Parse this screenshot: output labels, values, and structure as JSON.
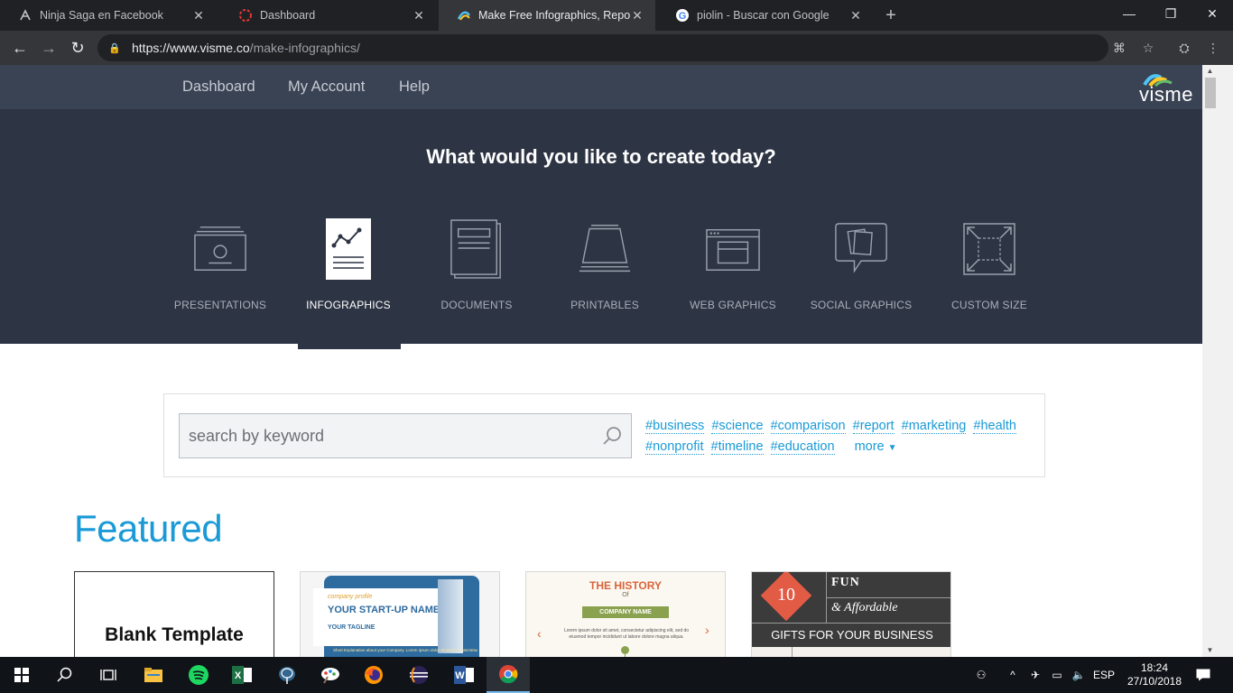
{
  "browser": {
    "tabs": [
      {
        "title": "Ninja Saga en Facebook",
        "icon": "ninja-icon"
      },
      {
        "title": "Dashboard",
        "icon": "dashboard-ring-icon"
      },
      {
        "title": "Make Free Infographics, Reports",
        "icon": "visme-icon",
        "active": true
      },
      {
        "title": "piolin - Buscar con Google",
        "icon": "google-icon"
      }
    ],
    "url_host": "https://www.visme.co",
    "url_path": "/make-infographics/"
  },
  "site": {
    "nav": [
      "Dashboard",
      "My Account",
      "Help"
    ],
    "logo": "visme"
  },
  "hero": {
    "heading": "What would you like to create today?",
    "categories": [
      {
        "label": "PRESENTATIONS",
        "icon": "presentation-icon"
      },
      {
        "label": "INFOGRAPHICS",
        "icon": "infographic-icon",
        "active": true
      },
      {
        "label": "DOCUMENTS",
        "icon": "document-icon"
      },
      {
        "label": "PRINTABLES",
        "icon": "printable-icon"
      },
      {
        "label": "WEB GRAPHICS",
        "icon": "web-graphic-icon"
      },
      {
        "label": "SOCIAL GRAPHICS",
        "icon": "social-graphic-icon"
      },
      {
        "label": "CUSTOM SIZE",
        "icon": "custom-size-icon"
      }
    ]
  },
  "search": {
    "placeholder": "search by keyword",
    "tags": [
      "#business",
      "#science",
      "#comparison",
      "#report",
      "#marketing",
      "#health",
      "#nonprofit",
      "#timeline",
      "#education"
    ],
    "more_label": "more"
  },
  "featured": {
    "heading": "Featured",
    "cards": [
      {
        "title": "Blank Template"
      },
      {
        "kicker": "company profile",
        "title": "YOUR START-UP NAME",
        "tagline": "YOUR TAGLINE",
        "footer": "Short Explanation about your Company. Lorem ipsum dolor sit amet, consectetur"
      },
      {
        "title": "THE HISTORY",
        "of": "Of",
        "banner": "COMPANY NAME",
        "body": "Lorem ipsum dolor sit amet, consectetur adipiscing elit, sed do eiusmod tempor incididunt ut labore dolore magna aliqua."
      },
      {
        "number": "10",
        "line1": "FUN",
        "line2": "& Affordable",
        "line3": "GIFTS FOR YOUR BUSINESS CLIENTS"
      }
    ]
  },
  "taskbar": {
    "lang": "ESP",
    "time": "18:24",
    "date": "27/10/2018"
  }
}
